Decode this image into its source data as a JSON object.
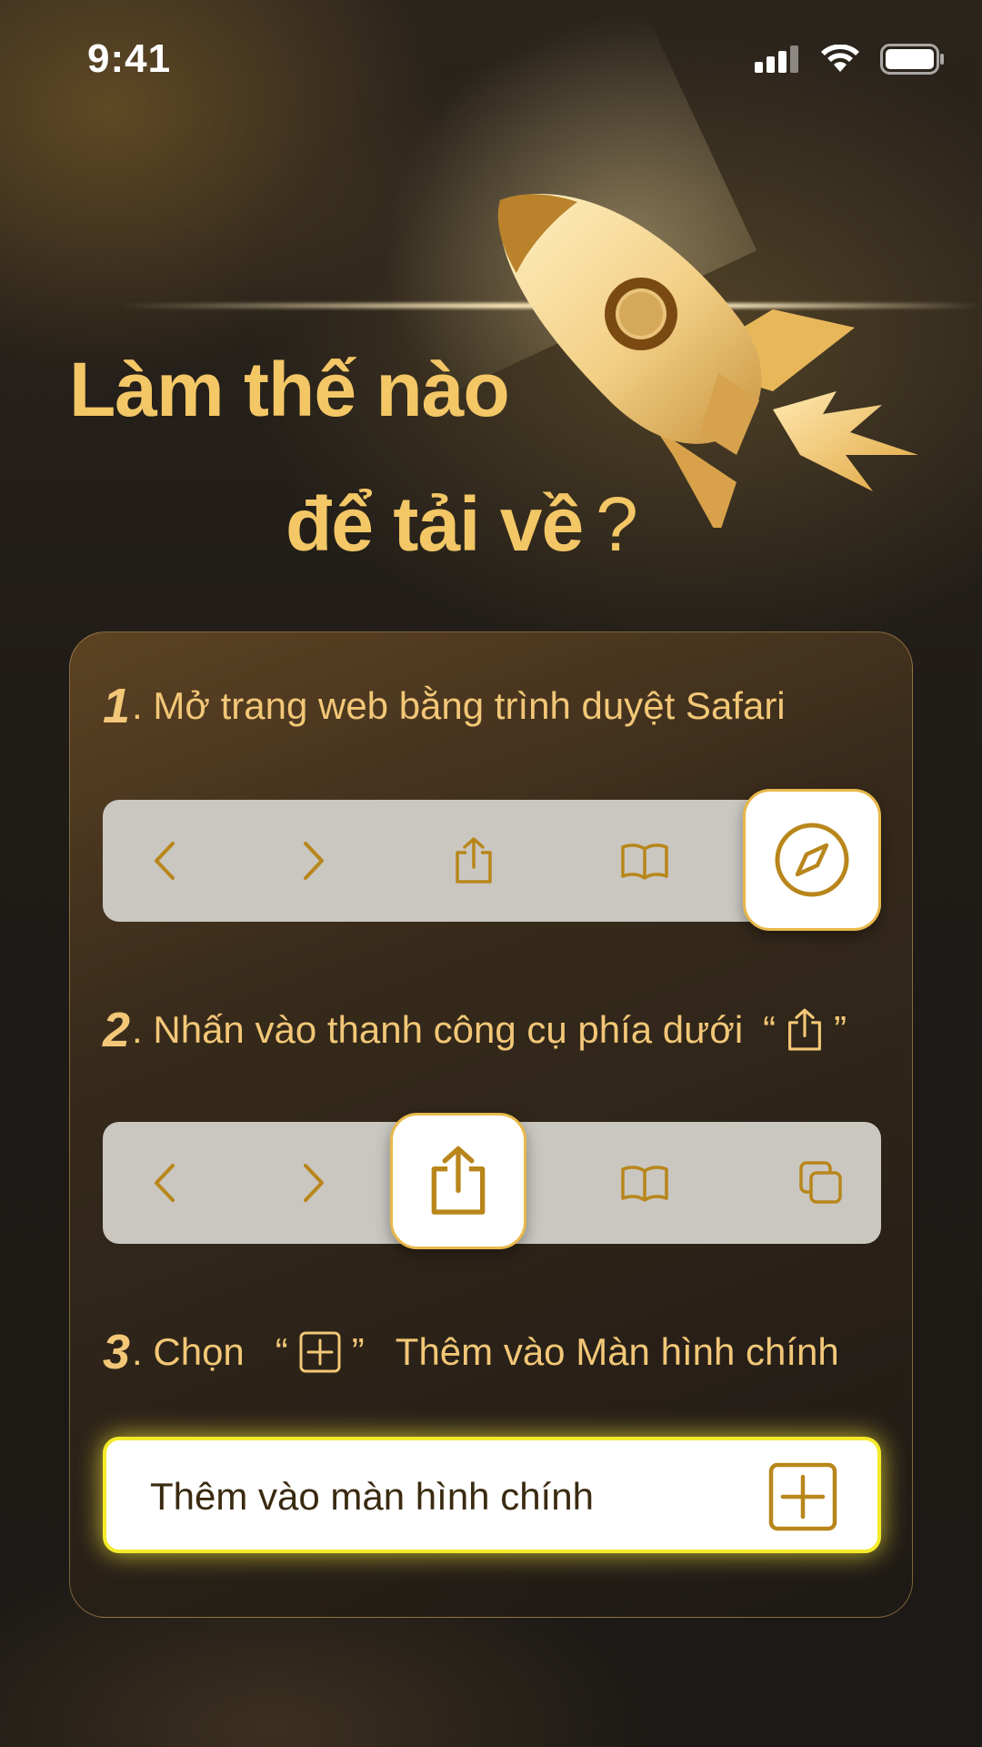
{
  "status_bar": {
    "time": "9:41"
  },
  "hero": {
    "title_line1": "Làm thế nào",
    "title_line2": "để tải về",
    "title_mark": "?"
  },
  "steps": [
    {
      "number": "1",
      "text": ". Mở trang web bằng trình duyệt Safari"
    },
    {
      "number": "2",
      "text": ". Nhấn vào thanh công cụ phía dưới",
      "open_quote": "“",
      "close_quote": "”"
    },
    {
      "number": "3",
      "text_before": ". Chọn",
      "open_quote": "“",
      "close_quote": "”",
      "text_after": "Thêm vào Màn hình chính"
    }
  ],
  "add_to_home": {
    "label": "Thêm vào màn hình chính"
  },
  "icons": {
    "toolbar_1": [
      "chevron-left-icon",
      "chevron-right-icon",
      "share-icon",
      "book-icon",
      "compass-icon"
    ],
    "toolbar_2": [
      "chevron-left-icon",
      "chevron-right-icon",
      "share-icon",
      "book-icon",
      "tabs-icon"
    ]
  },
  "colors": {
    "gold": "#f4c766",
    "icon_gold": "#b8861b",
    "toolbar_bg": "#cac7c1",
    "highlight_border": "#f4ea2a"
  }
}
